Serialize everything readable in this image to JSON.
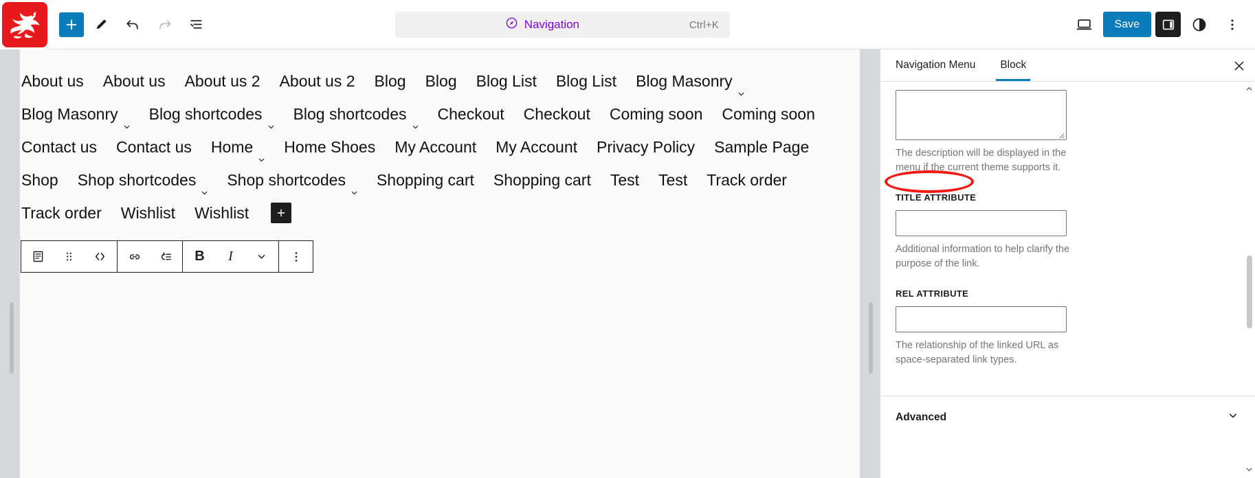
{
  "app": {
    "site_icon_name": "dragon-site-logo"
  },
  "toolbar": {
    "add_block_label": "+",
    "add_block_name": "add-block-button",
    "tools": [
      {
        "name": "edit-pencil-tool",
        "label": "Edit"
      },
      {
        "name": "undo-button",
        "label": "Undo"
      },
      {
        "name": "redo-button",
        "label": "Redo"
      },
      {
        "name": "list-view-button",
        "label": "Document Overview"
      }
    ]
  },
  "command_bar": {
    "label": "Navigation",
    "shortcut": "Ctrl+K",
    "icon": "navigation-compass-icon",
    "accent_color": "#7f07e0"
  },
  "topbar_right": {
    "view_icon": "desktop-preview-icon",
    "save_label": "Save",
    "save_color": "#0b7cba",
    "settings_icon": "settings-sidebar-icon",
    "styles_icon": "styles-contrast-icon",
    "options_icon": "more-options-icon"
  },
  "canvas": {
    "nav_items": [
      {
        "label": "About us",
        "has_submenu": false
      },
      {
        "label": "About us",
        "has_submenu": false
      },
      {
        "label": "About us 2",
        "has_submenu": false
      },
      {
        "label": "About us 2",
        "has_submenu": false
      },
      {
        "label": "Blog",
        "has_submenu": false
      },
      {
        "label": "Blog",
        "has_submenu": false
      },
      {
        "label": "Blog List",
        "has_submenu": false
      },
      {
        "label": "Blog List",
        "has_submenu": false
      },
      {
        "label": "Blog Masonry",
        "has_submenu": true
      },
      {
        "label": "Blog Masonry",
        "has_submenu": true
      },
      {
        "label": "Blog shortcodes",
        "has_submenu": true
      },
      {
        "label": "Blog shortcodes",
        "has_submenu": true
      },
      {
        "label": "Checkout",
        "has_submenu": false
      },
      {
        "label": "Checkout",
        "has_submenu": false
      },
      {
        "label": "Coming soon",
        "has_submenu": false
      },
      {
        "label": "Coming soon",
        "has_submenu": false
      },
      {
        "label": "Contact us",
        "has_submenu": false
      },
      {
        "label": "Contact us",
        "has_submenu": false
      },
      {
        "label": "Home",
        "has_submenu": true
      },
      {
        "label": "Home Shoes",
        "has_submenu": false
      },
      {
        "label": "My Account",
        "has_submenu": false
      },
      {
        "label": "My Account",
        "has_submenu": false
      },
      {
        "label": "Privacy Policy",
        "has_submenu": false
      },
      {
        "label": "Sample Page",
        "has_submenu": false
      },
      {
        "label": "Shop",
        "has_submenu": false
      },
      {
        "label": "Shop shortcodes",
        "has_submenu": true
      },
      {
        "label": "Shop shortcodes",
        "has_submenu": true
      },
      {
        "label": "Shopping cart",
        "has_submenu": false
      },
      {
        "label": "Shopping cart",
        "has_submenu": false
      },
      {
        "label": "Test",
        "has_submenu": false
      },
      {
        "label": "Test",
        "has_submenu": false
      },
      {
        "label": "Track order",
        "has_submenu": false
      },
      {
        "label": "Track order",
        "has_submenu": false
      },
      {
        "label": "Wishlist",
        "has_submenu": false
      },
      {
        "label": "Wishlist",
        "has_submenu": false
      }
    ],
    "append_button_label": "+"
  },
  "block_toolbar": {
    "items": [
      {
        "name": "block-type-page-icon",
        "label": "Page Link"
      },
      {
        "name": "drag-handle-icon",
        "label": "Drag"
      },
      {
        "name": "move-arrows-icon",
        "label": "Move"
      },
      {
        "name": "link-icon",
        "label": "Link"
      },
      {
        "name": "submenu-icon",
        "label": "Add submenu"
      },
      {
        "name": "bold-button",
        "label": "B"
      },
      {
        "name": "italic-button",
        "label": "I"
      },
      {
        "name": "more-rich-text-chevron-icon",
        "label": "More"
      },
      {
        "name": "block-options-ellipsis-icon",
        "label": "Options"
      }
    ]
  },
  "inspector": {
    "tabs": [
      {
        "label": "Navigation Menu",
        "active": false
      },
      {
        "label": "Block",
        "active": true
      }
    ],
    "close_label": "Close Settings",
    "description_help": "The description will be displayed in the menu if the current theme supports it.",
    "title_attribute_label": "Title attribute",
    "title_attribute_value": "",
    "title_attribute_help": "Additional information to help clarify the purpose of the link.",
    "rel_attribute_label": "Rel attribute",
    "rel_attribute_value": "",
    "rel_attribute_help": "The relationship of the linked URL as space-separated link types.",
    "advanced_label": "Advanced",
    "annotation_color": "#ee1b13",
    "active_tab_color": "#0b7cba"
  }
}
